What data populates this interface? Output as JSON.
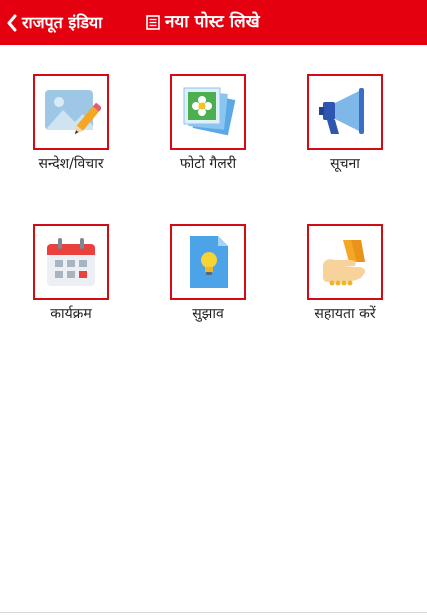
{
  "header": {
    "back_label": "राजपूत इंडिया",
    "title": "नया पोस्ट लिखे",
    "bg_color": "#e50010"
  },
  "tiles": [
    {
      "label": "सन्देश/विचार",
      "icon": "image-edit-icon"
    },
    {
      "label": "फोटो गैलरी",
      "icon": "photo-gallery-icon"
    },
    {
      "label": "सूचना",
      "icon": "megaphone-icon"
    },
    {
      "label": "कार्यक्रम",
      "icon": "calendar-icon"
    },
    {
      "label": "सुझाव",
      "icon": "idea-document-icon"
    },
    {
      "label": "सहायता करें",
      "icon": "donation-hand-icon"
    }
  ],
  "accent_border_color": "#d10c14"
}
